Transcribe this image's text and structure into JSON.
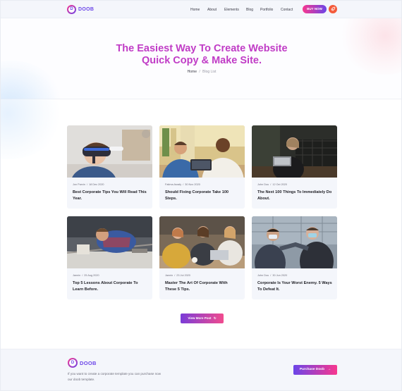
{
  "brand": {
    "logo_letter": "D",
    "name": "DOOB"
  },
  "nav": {
    "items": [
      "Home",
      "About",
      "Elements",
      "Blog",
      "Portfolio",
      "Contact"
    ],
    "buy_button": "BUY NOW",
    "action_icon": "rocket-icon"
  },
  "hero": {
    "title_line1": "The Easiest Way To Create Website",
    "title_line2": "Quick Copy & Make Site.",
    "breadcrumb_home": "Home",
    "breadcrumb_separator": "/",
    "breadcrumb_current": "Blog List"
  },
  "posts": [
    {
      "author": "Jon Parvin",
      "date": "18 Dec 2020",
      "title": "Best Corporate Tips You Will Read This Year.",
      "image": "vr-headset-photo"
    },
    {
      "author": "Fatima Asrafy",
      "date": "30 Nov 2020",
      "title": "Should Fixing Corporate Take 100 Steps.",
      "image": "business-meeting-photo"
    },
    {
      "author": "John Dou",
      "date": "12 Oct 2020",
      "title": "The Next 100 Things To Immediately Do About.",
      "image": "laptop-woman-photo"
    },
    {
      "author": "Jannin",
      "date": "25 Aug 2020",
      "title": "Top 5 Lessons About Corporate To Learn Before.",
      "image": "workshop-photo"
    },
    {
      "author": "Jannin",
      "date": "23 Jul 2020",
      "title": "Master The Art Of Corporate With These 5 Tips.",
      "image": "team-laptop-photo"
    },
    {
      "author": "John Dou",
      "date": "30 Jun 2020",
      "title": "Corporate Is Your Worst Enemy. 5 Ways To Defeat It.",
      "image": "elbow-bump-photo"
    }
  ],
  "meta_separator": "/",
  "view_more": {
    "label": "View More Post",
    "icon": "refresh-icon"
  },
  "footer": {
    "logo_letter": "D",
    "name": "DOOB",
    "text": "If you want to create a corporate template you can purchase now our doob template.",
    "purchase_button": "Purchase Doob",
    "purchase_icon": "arrow-right-icon"
  },
  "colors": {
    "accent_pink": "#f8378e",
    "accent_purple": "#6b45e8",
    "title_magenta": "#c03cc6",
    "icon_orange": "#f45a3a"
  }
}
